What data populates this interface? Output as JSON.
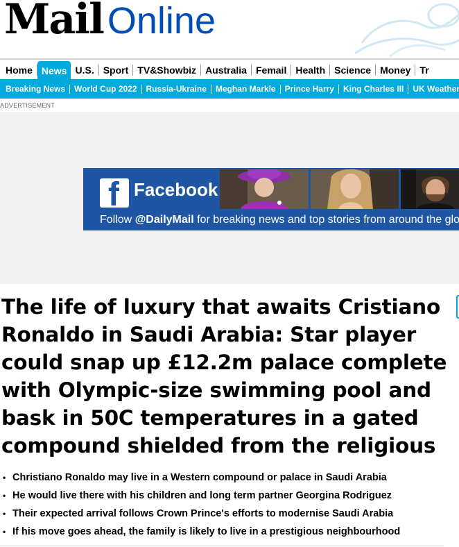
{
  "masthead": {
    "logo_bold": "Mail",
    "logo_light": "Online"
  },
  "nav": {
    "primary": [
      "Home",
      "News",
      "U.S.",
      "Sport",
      "TV&Showbiz",
      "Australia",
      "Femail",
      "Health",
      "Science",
      "Money",
      "Tr"
    ],
    "active": "News",
    "secondary": [
      "Breaking News",
      "World Cup 2022",
      "Russia-Ukraine",
      "Meghan Markle",
      "Prince Harry",
      "King Charles III",
      "UK Weather"
    ]
  },
  "advertisement_label": "ADVERTISEMENT",
  "facebook_ad": {
    "brand": "Facebook",
    "follow_prefix": "Follow ",
    "handle": "@DailyMail",
    "follow_suffix": " for breaking news and top stories from around the globe"
  },
  "article": {
    "headline": "The life of luxury that awaits Cristiano Ronaldo in Saudi Arabia: Star player could snap up £12.2m palace complete with Olympic-size swimming pool and bask in 50C temperatures in a gated compound shielded from the religious",
    "bullets": [
      "Christiano Ronaldo may live in a Western compound or palace in Saudi Arabia",
      "He would live there with his children and long term partner Georgina Rodriguez",
      "Their expected arrival follows Crown Prince's efforts to modernise Saudi Arabia",
      "If his move goes ahead, the family is likely to live in a prestigious neighbourhood"
    ]
  },
  "colors": {
    "accent": "#00aadd",
    "logo_blue": "#004db3",
    "facebook_blue": "#1f56a3"
  }
}
